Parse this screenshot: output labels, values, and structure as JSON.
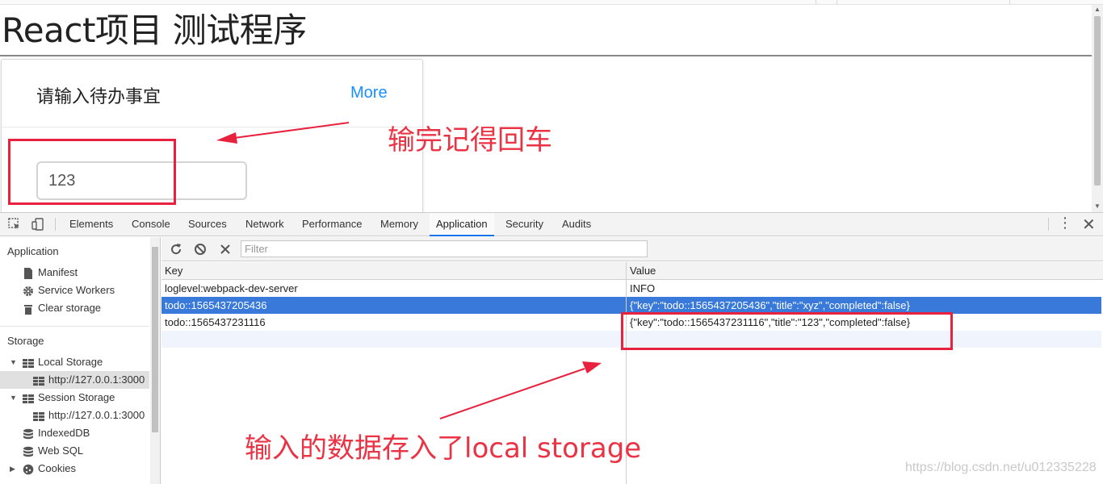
{
  "page": {
    "title": "React项目 测试程序",
    "card": {
      "title": "请输入待办事宜",
      "more_link": "More",
      "input_value": "123"
    }
  },
  "devtools": {
    "tabs": [
      {
        "label": "Elements"
      },
      {
        "label": "Console"
      },
      {
        "label": "Sources"
      },
      {
        "label": "Network"
      },
      {
        "label": "Performance"
      },
      {
        "label": "Memory"
      },
      {
        "label": "Application",
        "active": true
      },
      {
        "label": "Security"
      },
      {
        "label": "Audits"
      }
    ],
    "sidebar": {
      "application_heading": "Application",
      "application_items": [
        "Manifest",
        "Service Workers",
        "Clear storage"
      ],
      "storage_heading": "Storage",
      "local_storage": "Local Storage",
      "local_storage_origin": "http://127.0.0.1:3000",
      "session_storage": "Session Storage",
      "session_storage_origin": "http://127.0.0.1:3000",
      "indexeddb": "IndexedDB",
      "websql": "Web SQL",
      "cookies": "Cookies"
    },
    "filter_placeholder": "Filter",
    "table": {
      "headers": {
        "key": "Key",
        "value": "Value"
      },
      "rows": [
        {
          "key": "loglevel:webpack-dev-server",
          "value": "INFO"
        },
        {
          "key": "todo::1565437205436",
          "value": "{\"key\":\"todo::1565437205436\",\"title\":\"xyz\",\"completed\":false}",
          "selected": true
        },
        {
          "key": "todo::1565437231116",
          "value": "{\"key\":\"todo::1565437231116\",\"title\":\"123\",\"completed\":false}"
        }
      ]
    }
  },
  "annotations": {
    "note_enter": "输完记得回车",
    "note_storage": "输入的数据存入了local storage",
    "color": "#e8223e"
  },
  "watermark": "https://blog.csdn.net/u012335228"
}
